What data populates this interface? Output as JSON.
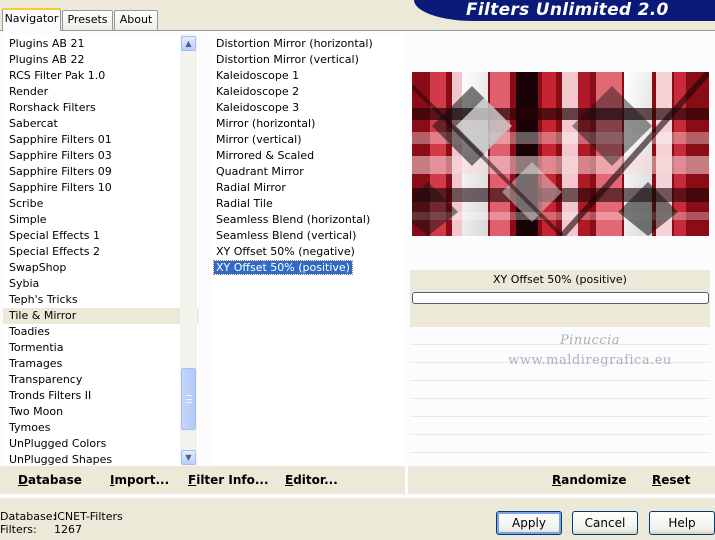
{
  "app": {
    "title": "Filters Unlimited 2.0"
  },
  "tabs": [
    {
      "label": "Navigator",
      "active": true
    },
    {
      "label": "Presets",
      "active": false
    },
    {
      "label": "About",
      "active": false
    }
  ],
  "categories": {
    "items": [
      "Plugins AB 21",
      "Plugins AB 22",
      "RCS Filter Pak 1.0",
      "Render",
      "Rorshack Filters",
      "Sabercat",
      "Sapphire Filters 01",
      "Sapphire Filters 03",
      "Sapphire Filters 09",
      "Sapphire Filters 10",
      "Scribe",
      "Simple",
      "Special Effects 1",
      "Special Effects 2",
      "SwapShop",
      "Sybia",
      "Teph's Tricks",
      "Tile & Mirror",
      "Toadies",
      "Tormentia",
      "Tramages",
      "Transparency",
      "Tronds Filters II",
      "Two Moon",
      "Tymoes",
      "UnPlugged Colors",
      "UnPlugged Shapes"
    ],
    "selected": "Tile & Mirror"
  },
  "filters": {
    "items": [
      "Distortion Mirror (horizontal)",
      "Distortion Mirror (vertical)",
      "Kaleidoscope 1",
      "Kaleidoscope 2",
      "Kaleidoscope 3",
      "Mirror (horizontal)",
      "Mirror (vertical)",
      "Mirrored & Scaled",
      "Quadrant Mirror",
      "Radial Mirror",
      "Radial Tile",
      "Seamless Blend (horizontal)",
      "Seamless Blend (vertical)",
      "XY Offset 50% (negative)",
      "XY Offset 50% (positive)"
    ],
    "selected": "XY Offset 50% (positive)"
  },
  "preview": {
    "filter_name": "XY Offset 50% (positive)",
    "progress": 0
  },
  "watermark": {
    "line1": "Pinuccia",
    "line2": "www.maldiregrafica.eu"
  },
  "toolbar": {
    "database": "Database",
    "import": "Import...",
    "filter_info": "Filter Info...",
    "editor": "Editor...",
    "randomize": "Randomize",
    "reset": "Reset"
  },
  "status": {
    "database_label": "Database:",
    "database_value": "ICNET-Filters",
    "filters_label": "Filters:",
    "filters_value": "1267"
  },
  "buttons": {
    "apply": "Apply",
    "cancel": "Cancel",
    "help": "Help"
  },
  "icons": {
    "scroll_up": "chevron-up-icon",
    "scroll_down": "chevron-down-icon"
  },
  "colors": {
    "banner": "#0a1a78",
    "selection": "#316ac5",
    "dialog_bg": "#ece9d8",
    "preview_red": "#b81828"
  }
}
